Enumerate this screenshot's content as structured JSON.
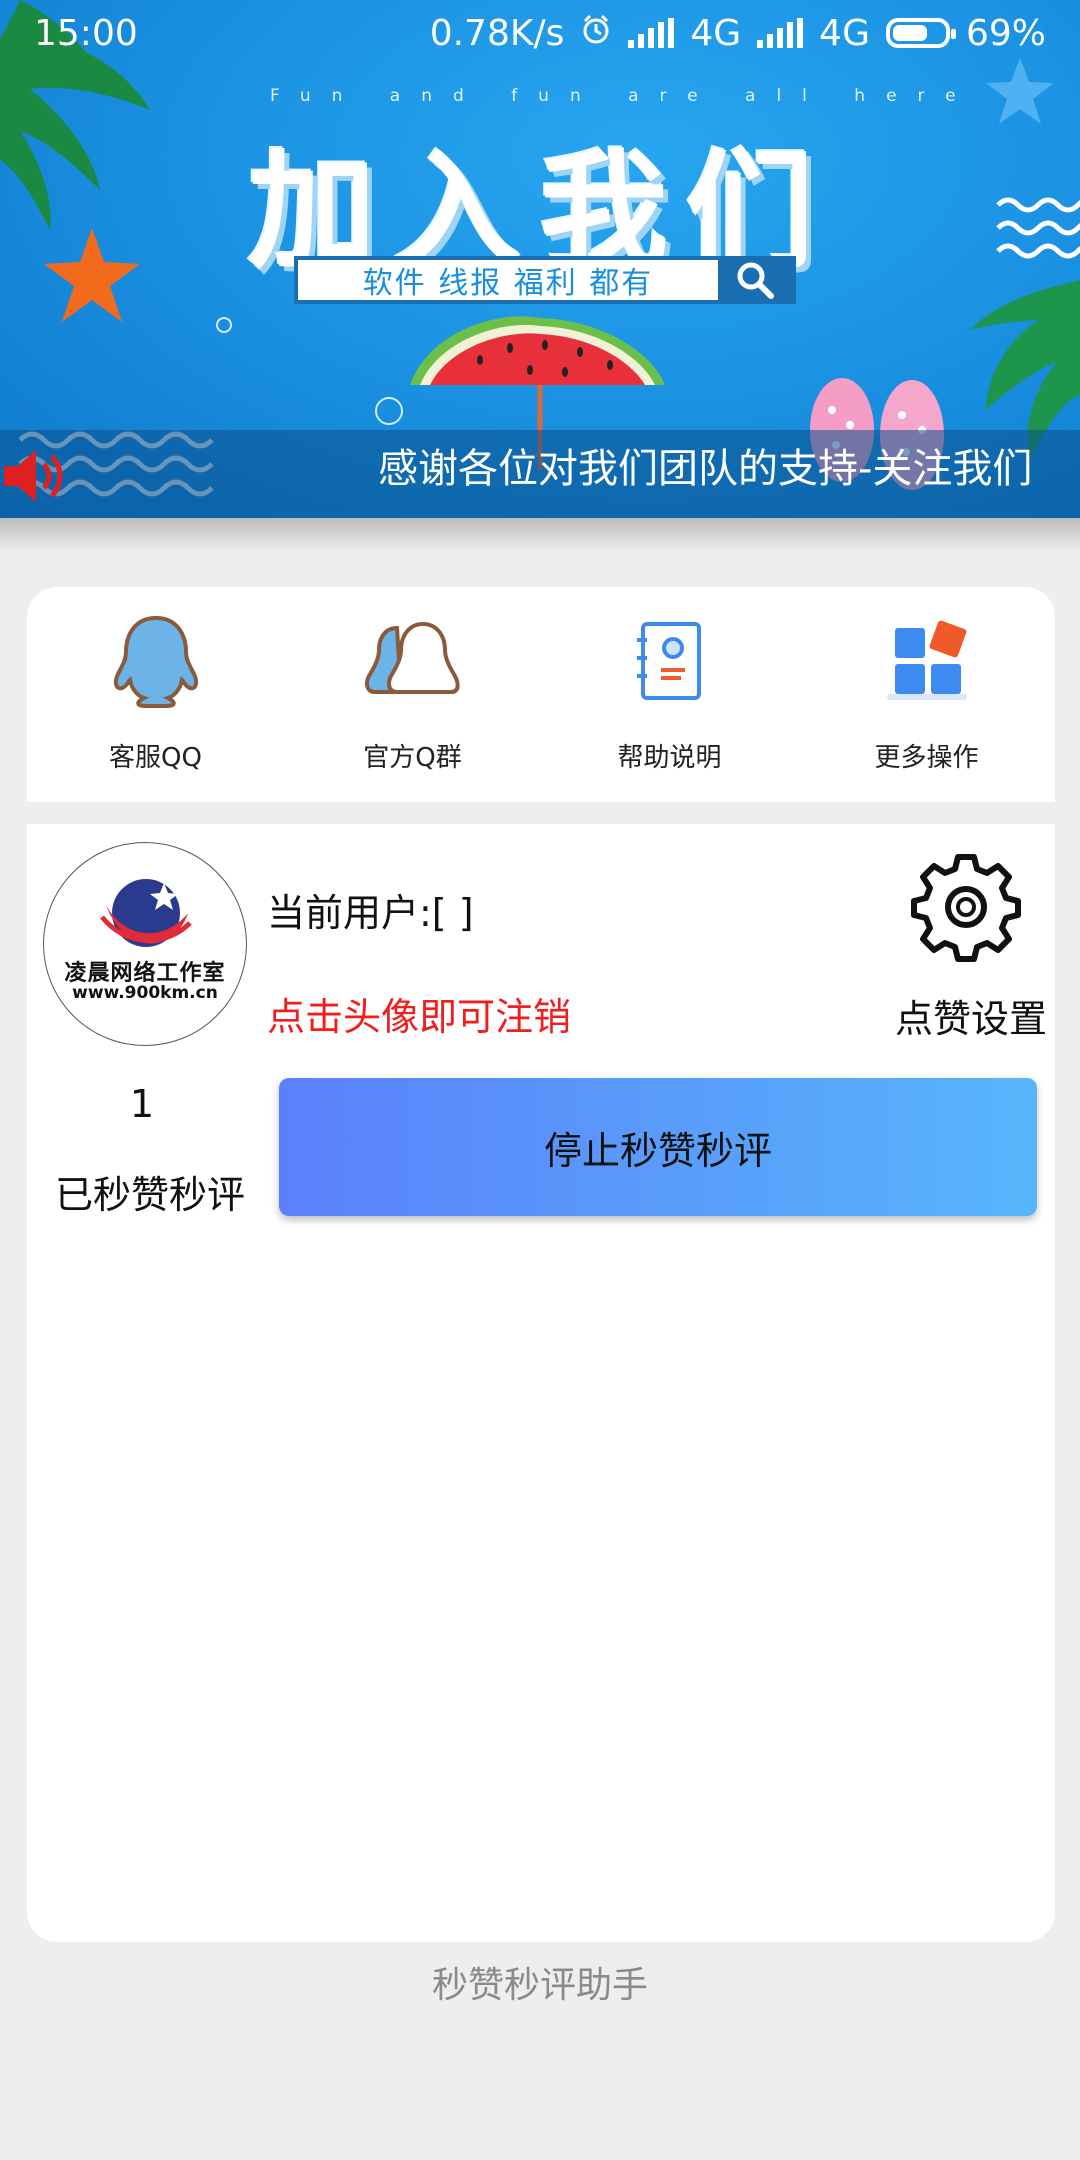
{
  "status_bar": {
    "time": "15:00",
    "net_speed": "0.78K/s",
    "network_1": "4G",
    "network_2": "4G",
    "battery": "69%",
    "battery_level": 0.69
  },
  "banner": {
    "subtitle": "Fun and fun are all here",
    "title": "加入我们",
    "search_text": "软件 线报 福利 都有",
    "marquee": "感谢各位对我们团队的支持-关注我们"
  },
  "quick_actions": [
    {
      "label": "客服QQ",
      "icon": "qq-penguin-icon"
    },
    {
      "label": "官方Q群",
      "icon": "qq-group-icon"
    },
    {
      "label": "帮助说明",
      "icon": "help-document-icon"
    },
    {
      "label": "更多操作",
      "icon": "more-apps-icon"
    }
  ],
  "user_panel": {
    "avatar_logo_text": "凌晨网络工作室",
    "avatar_logo_url": "www.900km.cn",
    "current_user": "当前用户:[   ]",
    "logout_hint": "点击头像即可注销",
    "like_settings_label": "点赞设置",
    "count_value": "1",
    "count_label": "已秒赞秒评",
    "stop_button_label": "停止秒赞秒评"
  },
  "colors": {
    "banner_blue": "#1c93e3",
    "hint_red": "#f21d1d",
    "button_gradient_start": "#5b80fb",
    "button_gradient_end": "#57b6fb"
  },
  "footer": "秒赞秒评助手"
}
